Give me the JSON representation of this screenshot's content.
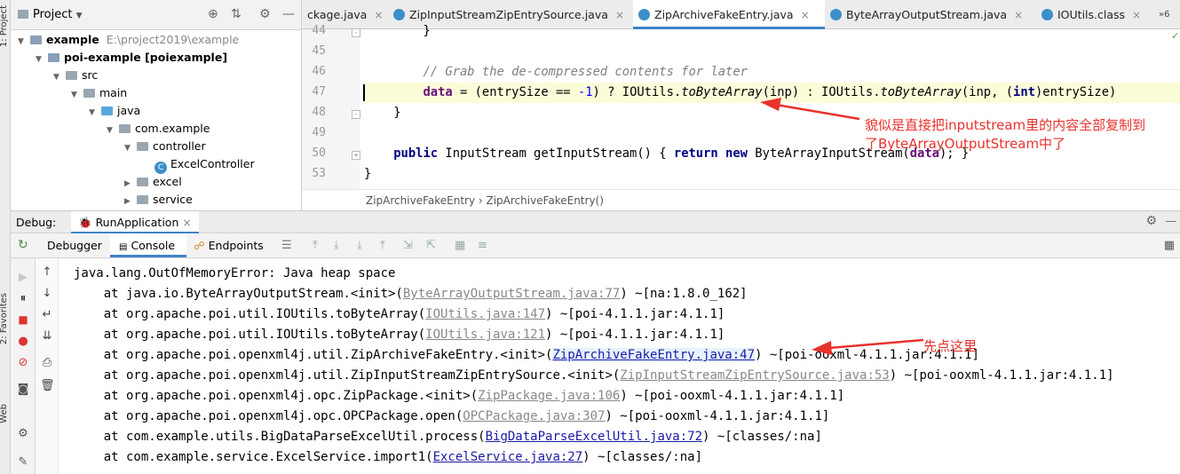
{
  "side_strip": {
    "top_label": "1: Project",
    "bottom_label_1": "2: Favorites",
    "bottom_label_2": "Web"
  },
  "project_panel": {
    "title": "Project",
    "tree": [
      {
        "level": 0,
        "label": "example",
        "suffix": "E:\\project2019\\example",
        "kind": "folder-mod",
        "arrow": "down"
      },
      {
        "level": 1,
        "label": "poi-example [poiexample]",
        "suffix": "",
        "kind": "folder-mod",
        "arrow": "down"
      },
      {
        "level": 2,
        "label": "src",
        "suffix": "",
        "kind": "folder",
        "arrow": "down"
      },
      {
        "level": 3,
        "label": "main",
        "suffix": "",
        "kind": "folder",
        "arrow": "down"
      },
      {
        "level": 4,
        "label": "java",
        "suffix": "",
        "kind": "folder-blue",
        "arrow": "down"
      },
      {
        "level": 5,
        "label": "com.example",
        "suffix": "",
        "kind": "folder",
        "arrow": "down"
      },
      {
        "level": 6,
        "label": "controller",
        "suffix": "",
        "kind": "folder",
        "arrow": "down"
      },
      {
        "level": 7,
        "label": "ExcelController",
        "suffix": "",
        "kind": "class",
        "arrow": ""
      },
      {
        "level": 6,
        "label": "excel",
        "suffix": "",
        "kind": "folder",
        "arrow": "right"
      },
      {
        "level": 6,
        "label": "service",
        "suffix": "",
        "kind": "folder",
        "arrow": "right"
      }
    ]
  },
  "editor": {
    "tabs": [
      {
        "label": "ckage.java",
        "active": false
      },
      {
        "label": "ZipInputStreamZipEntrySource.java",
        "active": false
      },
      {
        "label": "ZipArchiveFakeEntry.java",
        "active": true
      },
      {
        "label": "ByteArrayOutputStream.java",
        "active": false
      },
      {
        "label": "IOUtils.class",
        "active": false
      }
    ],
    "tab_overflow": "6",
    "line_numbers": [
      "44",
      "45",
      "46",
      "47",
      "48",
      "49",
      "50",
      "53"
    ],
    "code": {
      "l44": "        }",
      "l46": "        // Grab the de-compressed contents for later",
      "l47_a": "        ",
      "l47_data": "data",
      "l47_b": " = (entrySize == ",
      "l47_num": "-1",
      "l47_c": ") ? IOUtils.",
      "l47_m1": "toByteArray",
      "l47_d": "(inp) : IOUtils.",
      "l47_m2": "toByteArray",
      "l47_e": "(inp, (",
      "l47_int": "int",
      "l47_f": ")entrySize)",
      "l48": "    }",
      "l50_kw": "public",
      "l50_a": " InputStream getInputStream() { ",
      "l50_ret": "return",
      "l50_b": " ",
      "l50_new": "new",
      "l50_c": " ByteArrayInputStream(",
      "l50_data": "data",
      "l50_d": "); }",
      "l53": "}"
    },
    "breadcrumb": "ZipArchiveFakeEntry  ›  ZipArchiveFakeEntry()",
    "annotation": "貌似是直接把inputstream里的内容全部复制到\n了ByteArrayOutputStream中了"
  },
  "debug": {
    "title": "Debug:",
    "run_config": "RunApplication",
    "tabs": [
      {
        "label": "Debugger",
        "active": false
      },
      {
        "label": "Console",
        "active": true
      },
      {
        "label": "Endpoints",
        "active": false
      }
    ],
    "console": {
      "line0": "java.lang.OutOfMemoryError: Java heap space",
      "frames": [
        {
          "pre": "    at java.io.ByteArrayOutputStream.<init>(",
          "link": "ByteArrayOutputStream.java:77",
          "post": ") ~[na:1.8.0_162]",
          "style": "gray"
        },
        {
          "pre": "    at org.apache.poi.util.IOUtils.toByteArray(",
          "link": "IOUtils.java:147",
          "post": ") ~[poi-4.1.1.jar:4.1.1]",
          "style": "gray"
        },
        {
          "pre": "    at org.apache.poi.util.IOUtils.toByteArray(",
          "link": "IOUtils.java:121",
          "post": ") ~[poi-4.1.1.jar:4.1.1]",
          "style": "gray"
        },
        {
          "pre": "    at org.apache.poi.openxml4j.util.ZipArchiveFakeEntry.<init>(",
          "link": "ZipArchiveFakeEntry.java:47",
          "post": ") ~[poi-ooxml-4.1.1.jar:4.1.1]",
          "style": "blue"
        },
        {
          "pre": "    at org.apache.poi.openxml4j.util.ZipInputStreamZipEntrySource.<init>(",
          "link": "ZipInputStreamZipEntrySource.java:53",
          "post": ") ~[poi-ooxml-4.1.1.jar:4.1.1]",
          "style": "gray"
        },
        {
          "pre": "    at org.apache.poi.openxml4j.opc.ZipPackage.<init>(",
          "link": "ZipPackage.java:106",
          "post": ") ~[poi-ooxml-4.1.1.jar:4.1.1]",
          "style": "gray"
        },
        {
          "pre": "    at org.apache.poi.openxml4j.opc.OPCPackage.open(",
          "link": "OPCPackage.java:307",
          "post": ") ~[poi-ooxml-4.1.1.jar:4.1.1]",
          "style": "gray"
        },
        {
          "pre": "    at com.example.utils.BigDataParseExcelUtil.process(",
          "link": "BigDataParseExcelUtil.java:72",
          "post": ") ~[classes/:na]",
          "style": "blue"
        },
        {
          "pre": "    at com.example.service.ExcelService.import1(",
          "link": "ExcelService.java:27",
          "post": ") ~[classes/:na]",
          "style": "blue"
        }
      ]
    },
    "annotation": "先点这里"
  },
  "colors": {
    "annotation": "#e8322d",
    "accent": "#4083c9",
    "link": "#1a1aa6",
    "keyword": "#000080"
  }
}
